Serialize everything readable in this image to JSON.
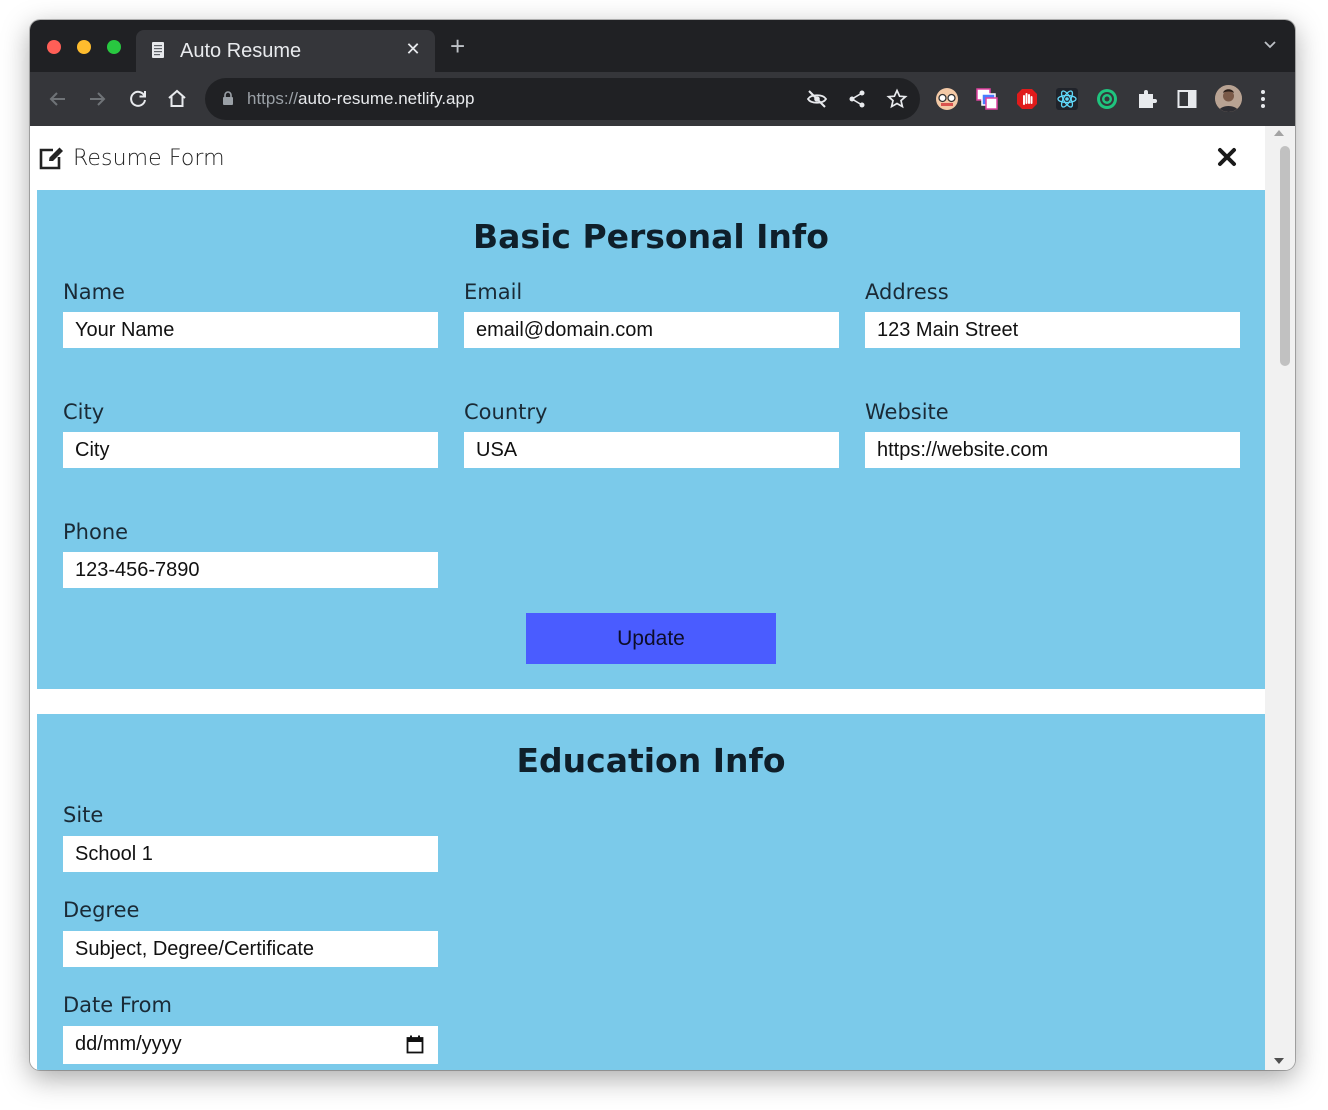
{
  "browser": {
    "tab_title": "Auto Resume",
    "url_scheme": "https://",
    "url_host": "auto-resume.netlify.app"
  },
  "form": {
    "title": "Resume Form"
  },
  "basic_info": {
    "title": "Basic Personal Info",
    "fields": {
      "name": {
        "label": "Name",
        "value": "Your Name"
      },
      "email": {
        "label": "Email",
        "value": "email@domain.com"
      },
      "address": {
        "label": "Address",
        "value": "123 Main Street"
      },
      "city": {
        "label": "City",
        "value": "City"
      },
      "country": {
        "label": "Country",
        "value": "USA"
      },
      "website": {
        "label": "Website",
        "value": "https://website.com"
      },
      "phone": {
        "label": "Phone",
        "value": "123-456-7890"
      }
    },
    "update_label": "Update"
  },
  "education": {
    "title": "Education Info",
    "fields": {
      "site": {
        "label": "Site",
        "value": "School 1"
      },
      "degree": {
        "label": "Degree",
        "value": "Subject, Degree/Certificate"
      },
      "date_from": {
        "label": "Date From",
        "value": "dd/mm/yyyy"
      }
    }
  },
  "colors": {
    "section_bg": "#7bcaea",
    "button_bg": "#4a5cff",
    "chrome_dark": "#202124",
    "chrome_toolbar": "#35363a"
  },
  "icons": [
    "document-favicon-icon",
    "close-tab-icon",
    "new-tab-icon",
    "tab-search-chevron-icon",
    "back-arrow-icon",
    "forward-arrow-icon",
    "reload-icon",
    "home-icon",
    "lock-icon",
    "eye-off-icon",
    "share-icon",
    "star-icon",
    "extension-glasses-icon",
    "extension-windows-icon",
    "extension-stop-hand-icon",
    "react-devtools-icon",
    "extension-target-icon",
    "puzzle-extensions-icon",
    "side-panel-icon",
    "profile-avatar",
    "kebab-menu-icon",
    "edit-icon",
    "close-icon",
    "calendar-icon"
  ]
}
